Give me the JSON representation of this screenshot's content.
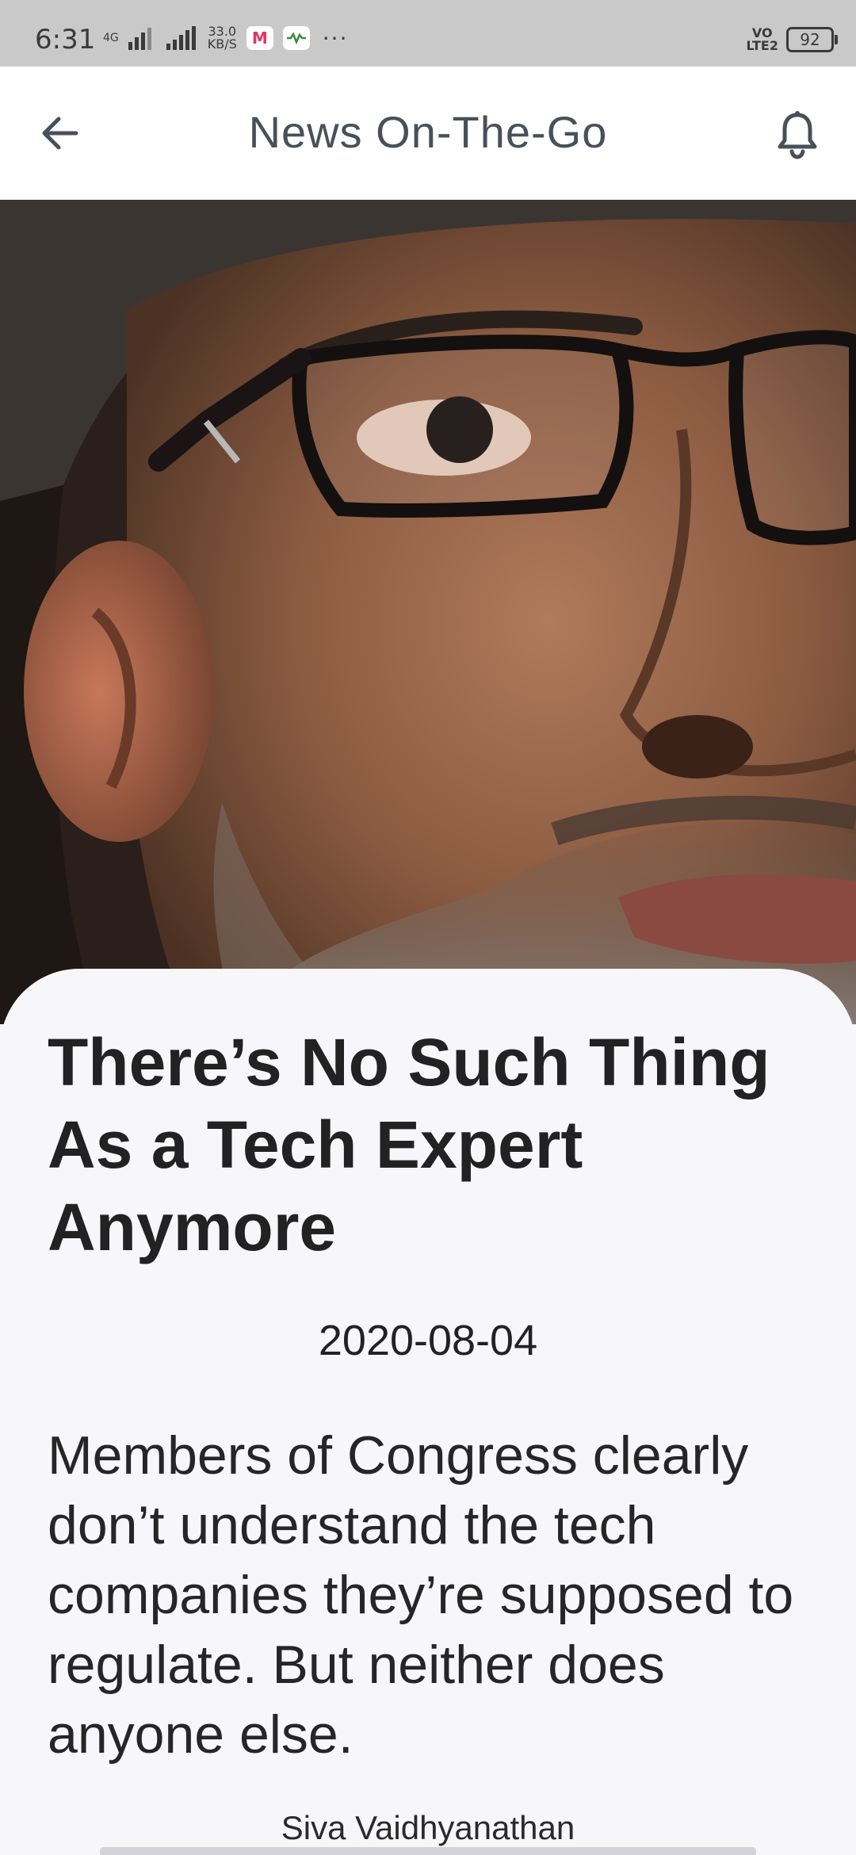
{
  "status_bar": {
    "time": "6:31",
    "network_type": "4G",
    "speed_value": "33.0",
    "speed_unit": "KB/S",
    "app_badge_1": "M",
    "more_indicator": "···",
    "volte_top": "VO",
    "volte_bottom": "LTE2",
    "battery": "92",
    "icons": [
      "signal-icon",
      "signal-icon",
      "myntra-app-icon",
      "app-notification-icon"
    ]
  },
  "app_bar": {
    "title": "News On-The-Go",
    "back_icon": "arrow-left-icon",
    "notification_icon": "bell-icon"
  },
  "hero_image": {
    "description_icon": "article-photo"
  },
  "article": {
    "headline": "There’s No Such Thing As a Tech Expert Anymore",
    "date": "2020-08-04",
    "summary": "Members of Congress clearly don’t understand the tech companies they’re supposed to regulate. But neither does anyone else.",
    "author": "Siva Vaidhyanathan"
  },
  "colors": {
    "status_bar_bg": "#c9c9c9",
    "app_bar_bg": "#ffffff",
    "card_bg": "#f7f7f9",
    "title_text": "#4a4f5a",
    "body_text": "#222222"
  }
}
